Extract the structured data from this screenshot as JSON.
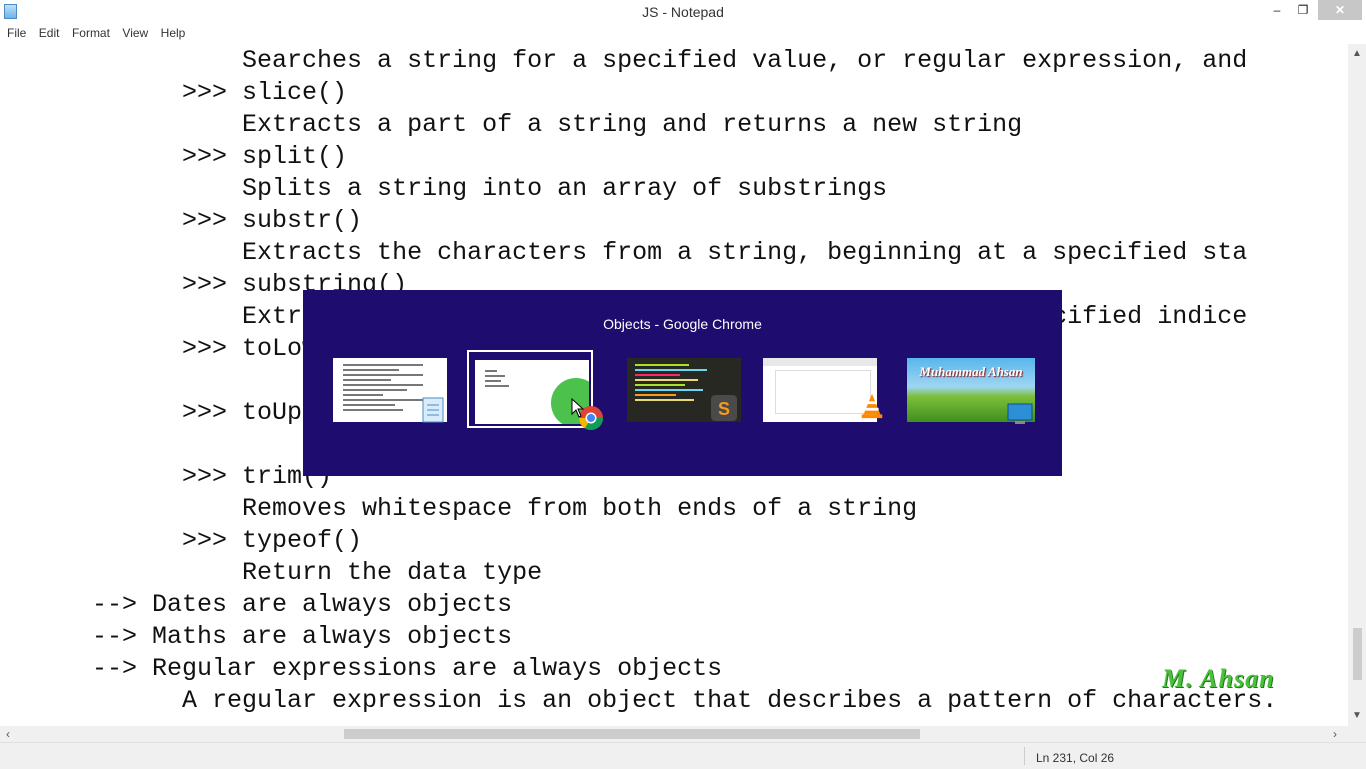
{
  "window": {
    "title": "JS - Notepad",
    "minimize_glyph": "–",
    "restore_glyph": "❐",
    "close_glyph": "✕"
  },
  "menu": [
    "File",
    "Edit",
    "Format",
    "View",
    "Help"
  ],
  "editor": {
    "lines": [
      "                Searches a string for a specified value, or regular expression, and",
      "            >>> slice()",
      "                Extracts a part of a string and returns a new string",
      "            >>> split()",
      "                Splits a string into an array of substrings",
      "            >>> substr()",
      "                Extracts the characters from a string, beginning at a specified sta",
      "            >>> substring()",
      "                Extracts the characters from a string, between two specified indice",
      "            >>> toLowerCase()",
      "",
      "            >>> toUpperCase()",
      "",
      "            >>> trim()",
      "                Removes whitespace from both ends of a string",
      "            >>> typeof()",
      "                Return the data type",
      "      --> Dates are always objects",
      "      --> Maths are always objects",
      "      --> Regular expressions are always objects",
      "            A regular expression is an object that describes a pattern of characters."
    ]
  },
  "status": {
    "position": "Ln 231, Col 26"
  },
  "watermark": "M. Ahsan",
  "task_switcher": {
    "title": "Objects - Google Chrome",
    "thumbnails": [
      {
        "app": "Notepad",
        "icon": "notepad-icon",
        "selected": false
      },
      {
        "app": "Google Chrome",
        "icon": "chrome-icon",
        "selected": true
      },
      {
        "app": "Sublime Text",
        "icon": "sublime-icon",
        "selected": false
      },
      {
        "app": "VLC media player",
        "icon": "vlc-icon",
        "selected": false
      },
      {
        "app": "Desktop",
        "icon": "desktop-icon",
        "selected": false,
        "caption": "Muhammad Ahsan"
      }
    ]
  },
  "colors": {
    "switcher_bg": "#1e0d6e",
    "watermark": "#4dbf3f"
  }
}
